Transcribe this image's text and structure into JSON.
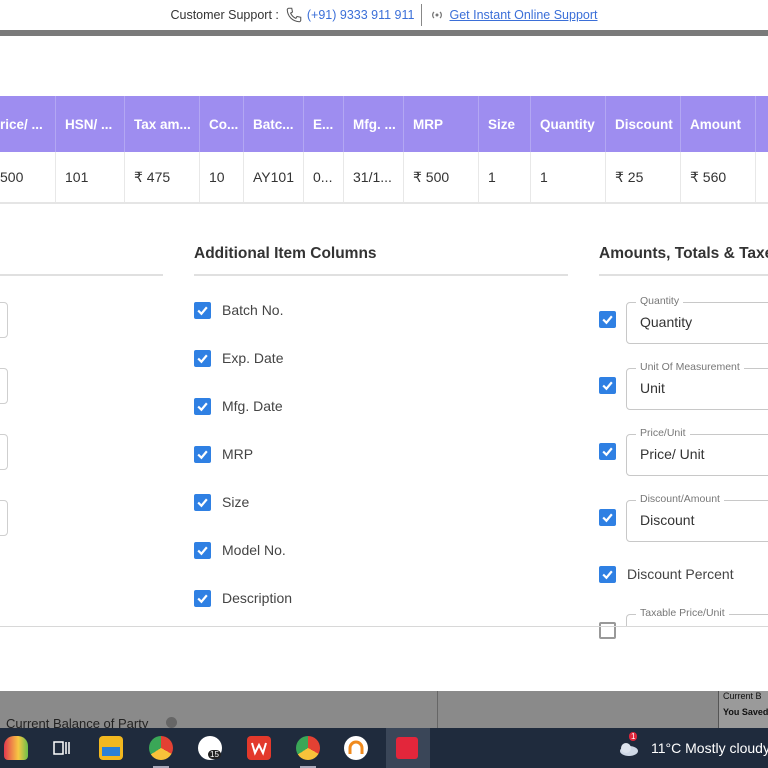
{
  "support": {
    "label": "Customer Support :",
    "phone": "(+91) 9333 911 911",
    "online_link": "Get Instant Online Support"
  },
  "table": {
    "headers": [
      "rice/ ...",
      "HSN/ ...",
      "Tax am...",
      "Co...",
      "Batc...",
      "E...",
      "Mfg. ...",
      "MRP",
      "Size",
      "Quantity",
      "Discount",
      "Amount",
      ""
    ],
    "row": [
      "500",
      "101",
      "₹ 475",
      "10",
      "AY101",
      "0...",
      "31/1...",
      "₹ 500",
      "1",
      "1",
      "₹ 25",
      "₹ 560",
      ""
    ]
  },
  "sections": {
    "additional": {
      "title": "Additional Item Columns",
      "items": [
        {
          "label": "Batch No.",
          "checked": true
        },
        {
          "label": "Exp. Date",
          "checked": true
        },
        {
          "label": "Mfg. Date",
          "checked": true
        },
        {
          "label": "MRP",
          "checked": true
        },
        {
          "label": "Size",
          "checked": true
        },
        {
          "label": "Model No.",
          "checked": true
        },
        {
          "label": "Description",
          "checked": true
        }
      ]
    },
    "amounts": {
      "title": "Amounts, Totals & Taxes",
      "fields": [
        {
          "legend": "Quantity",
          "value": "Quantity",
          "checked": true
        },
        {
          "legend": "Unit Of Measurement",
          "value": "Unit",
          "checked": true
        },
        {
          "legend": "Price/Unit",
          "value": "Price/ Unit",
          "checked": true
        },
        {
          "legend": "Discount/Amount",
          "value": "Discount",
          "checked": true
        }
      ],
      "discount_percent": {
        "label": "Discount Percent",
        "checked": true
      },
      "taxable_price": {
        "legend": "Taxable Price/Unit",
        "checked": false
      }
    }
  },
  "background": {
    "current_balance": "Current Balance of Party",
    "panel_lines": [
      "Current B",
      "You Saved"
    ]
  },
  "taskbar": {
    "weather": "11°C  Mostly cloudy",
    "chrome_badge": "15",
    "notif_badge": "1"
  },
  "colors": {
    "accent": "#2f80e3",
    "header": "#9e8df0",
    "link": "#3b6fd8"
  }
}
